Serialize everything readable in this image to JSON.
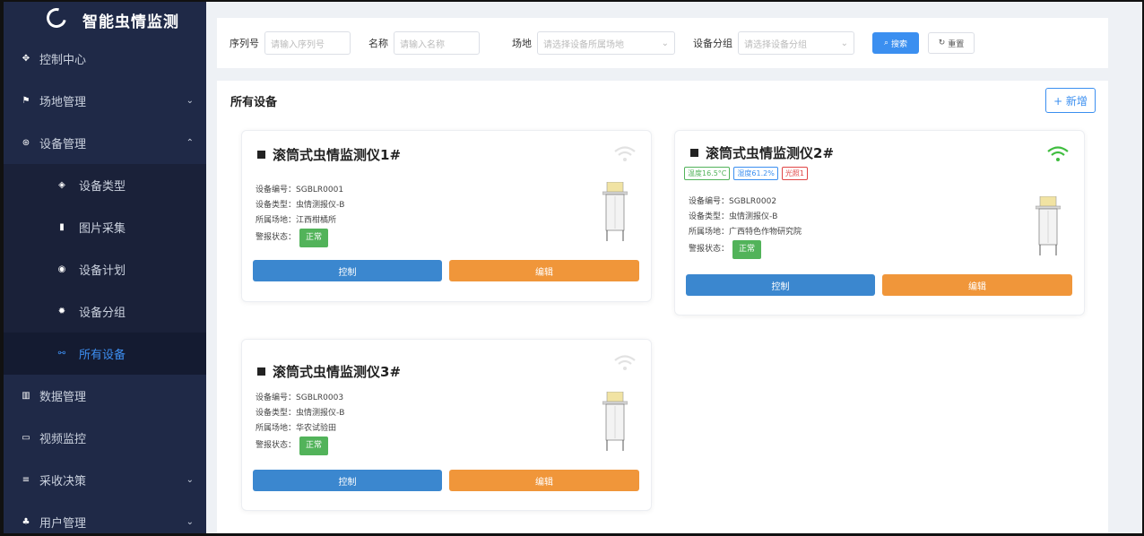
{
  "app": {
    "title": "智能虫情监测"
  },
  "sidebar": {
    "items": [
      {
        "label": "控制中心",
        "icon": "gear-icon",
        "glyph": "✥"
      },
      {
        "label": "场地管理",
        "icon": "flag-icon",
        "glyph": "⚑"
      },
      {
        "label": "设备管理",
        "icon": "device-icon",
        "glyph": "⊛"
      },
      {
        "label": "数据管理",
        "icon": "chart-icon",
        "glyph": "▥"
      },
      {
        "label": "视频监控",
        "icon": "monitor-icon",
        "glyph": "▭"
      },
      {
        "label": "采收决策",
        "icon": "database-icon",
        "glyph": "≡"
      },
      {
        "label": "用户管理",
        "icon": "users-icon",
        "glyph": "♣"
      }
    ],
    "sub_items": [
      {
        "label": "设备类型",
        "icon": "cube-icon",
        "glyph": "◈"
      },
      {
        "label": "图片采集",
        "icon": "document-icon",
        "glyph": "▮"
      },
      {
        "label": "设备计划",
        "icon": "compass-icon",
        "glyph": "◉"
      },
      {
        "label": "设备分组",
        "icon": "cog-icon",
        "glyph": "✹"
      },
      {
        "label": "所有设备",
        "icon": "link-icon",
        "glyph": "⚯"
      }
    ]
  },
  "search": {
    "serial_label": "序列号",
    "serial_placeholder": "请输入序列号",
    "name_label": "名称",
    "name_placeholder": "请输入名称",
    "site_label": "场地",
    "site_placeholder": "请选择设备所属场地",
    "group_label": "设备分组",
    "group_placeholder": "请选择设备分组",
    "search_button": "搜索",
    "reset_button": "重置"
  },
  "main": {
    "section_title": "所有设备",
    "add_button": "+ 新增"
  },
  "labels": {
    "code": "设备编号：",
    "type": "设备类型：",
    "site": "所属场地：",
    "alarm": "警报状态：",
    "control": "控制",
    "edit": "编辑"
  },
  "devices": [
    {
      "title": "滚筒式虫情监测仪1#",
      "code": "SGBLR0001",
      "type": "虫情测报仪-B",
      "site": "江西柑橘所",
      "status": "正常",
      "online": false
    },
    {
      "title": "滚筒式虫情监测仪2#",
      "code": "SGBLR0002",
      "type": "虫情测报仪-B",
      "site": "广西特色作物研究院",
      "status": "正常",
      "online": true,
      "tags": [
        "温度16.5°C",
        "湿度61.2%",
        "光照1"
      ]
    },
    {
      "title": "滚筒式虫情监测仪3#",
      "code": "SGBLR0003",
      "type": "虫情测报仪-B",
      "site": "华农试验田",
      "status": "正常",
      "online": false
    }
  ],
  "colors": {
    "sidebar_bg": "#1f2947",
    "active": "#3d8ef0",
    "control": "#3b87cf",
    "edit": "#f0963a",
    "ok": "#52b35a",
    "wifi_on": "#3fbd3f",
    "wifi_off": "#e2e2e2"
  }
}
